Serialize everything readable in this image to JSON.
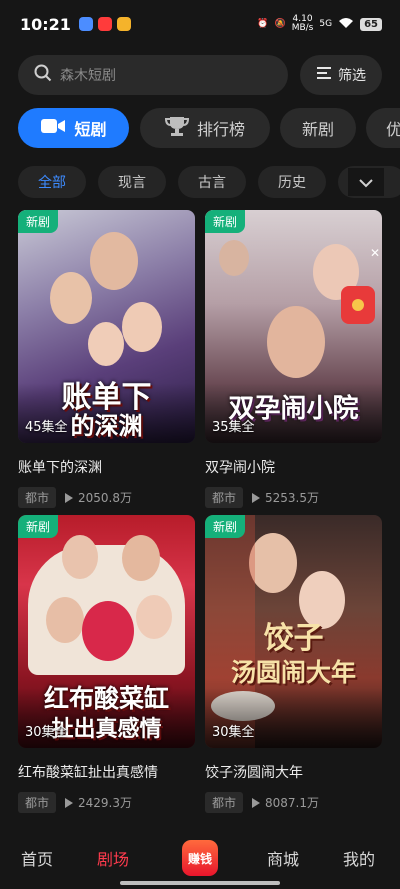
{
  "status": {
    "time": "10:21",
    "speed_value": "4.10",
    "speed_unit": "MB/s",
    "network": "5G",
    "battery": "65"
  },
  "search": {
    "placeholder": "森木短剧",
    "filter_label": "筛选"
  },
  "main_tabs": [
    {
      "label": "短剧",
      "active": true
    },
    {
      "label": "排行榜",
      "active": false
    },
    {
      "label": "新剧",
      "active": false
    },
    {
      "label": "优",
      "active": false
    }
  ],
  "sub_tabs": [
    {
      "label": "全部",
      "active": true
    },
    {
      "label": "现言",
      "active": false
    },
    {
      "label": "古言",
      "active": false
    },
    {
      "label": "历史",
      "active": false
    }
  ],
  "dramas": [
    {
      "badge": "新剧",
      "poster_text": [
        "账单下",
        "的深渊"
      ],
      "episodes": "45集全",
      "title": "账单下的深渊",
      "genre": "都市",
      "plays": "2050.8万"
    },
    {
      "badge": "新剧",
      "poster_text": [
        "双孕闹小院"
      ],
      "episodes": "35集全",
      "title": "双孕闹小院",
      "genre": "都市",
      "plays": "5253.5万"
    },
    {
      "badge": "新剧",
      "poster_text": [
        "红布酸菜缸",
        "扯出真感情"
      ],
      "episodes": "30集全",
      "title": "红布酸菜缸扯出真感情",
      "genre": "都市",
      "plays": "2429.3万"
    },
    {
      "badge": "新剧",
      "poster_text": [
        "饺子",
        "汤圆闹大年"
      ],
      "episodes": "30集全",
      "title": "饺子汤圆闹大年",
      "genre": "都市",
      "plays": "8087.1万"
    }
  ],
  "bottom_nav": [
    {
      "label": "首页",
      "active": false
    },
    {
      "label": "剧场",
      "active": true
    },
    {
      "label": "赚钱",
      "active": false
    },
    {
      "label": "商城",
      "active": false
    },
    {
      "label": "我的",
      "active": false
    }
  ],
  "colors": {
    "accent": "#1f7bff",
    "nav_active": "#ff3b4d",
    "badge": "#15b07a"
  }
}
